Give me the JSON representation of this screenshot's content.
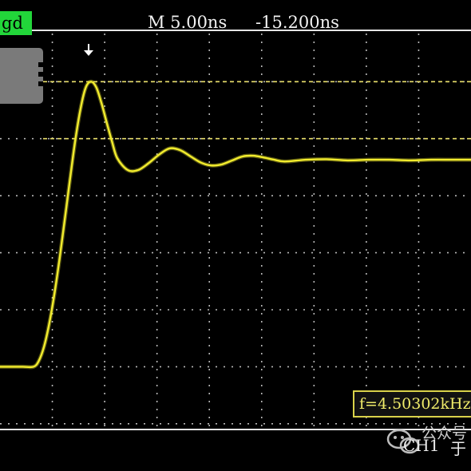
{
  "header": {
    "status_badge": "gd",
    "timebase": "M  5.00ns",
    "delay": "-15.200ns"
  },
  "measurement": {
    "frequency": "f=4.50302kHz"
  },
  "channel": {
    "label": "CH1",
    "suffix": "于"
  },
  "watermark": {
    "text": "公众号"
  },
  "colors": {
    "trace": "#f2ec2e",
    "grid": "#d8d8d8",
    "cursor": "#e9df6a",
    "badge": "#22d63a",
    "frame": "#e6e6e6"
  },
  "icons": {
    "trigger": "down-arrow-icon",
    "watermark": "wechat-icon"
  },
  "chart_data": {
    "type": "line",
    "title": "",
    "xlabel": "",
    "ylabel": "",
    "x_unit": "ns",
    "x_per_division": 5.0,
    "x": [
      -15.2,
      -14.0,
      -13.0,
      -12.0,
      -11.5,
      -11.0,
      -10.5,
      -10.0,
      -9.5,
      -9.0,
      -8.5,
      -8.0,
      -7.5,
      -7.0,
      -6.5,
      -6.0,
      -5.5,
      -5.0,
      -4.5,
      -4.0,
      -3.0,
      -2.0,
      -1.0,
      0.0,
      1.0,
      2.0,
      3.0,
      4.0,
      5.0,
      6.0,
      7.0,
      8.0,
      9.0,
      10.0,
      11.0,
      12.0,
      14.0,
      16.0,
      18.0,
      20.0,
      22.0,
      24.0,
      26.0,
      28.0,
      29.8
    ],
    "y": [
      -2.0,
      -2.0,
      -2.0,
      -2.0,
      -1.9,
      -1.65,
      -1.25,
      -0.72,
      -0.1,
      0.6,
      1.3,
      1.98,
      2.53,
      2.9,
      3.0,
      2.9,
      2.62,
      2.28,
      1.95,
      1.66,
      1.45,
      1.45,
      1.57,
      1.72,
      1.83,
      1.8,
      1.69,
      1.58,
      1.53,
      1.55,
      1.62,
      1.69,
      1.7,
      1.67,
      1.63,
      1.6,
      1.63,
      1.64,
      1.62,
      1.63,
      1.63,
      1.62,
      1.63,
      1.63,
      1.63
    ],
    "y_unit": "div",
    "xlim": [
      -15.2,
      29.8
    ],
    "ylim": [
      -3.1,
      3.9
    ],
    "grid": true,
    "cursors_y": [
      3.0,
      2.0
    ]
  }
}
